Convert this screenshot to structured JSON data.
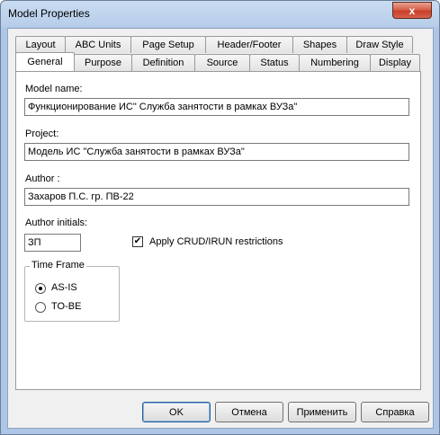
{
  "window": {
    "title": "Model Properties",
    "close_glyph": "x",
    "close_icon": "close-icon"
  },
  "tabs": {
    "row1": [
      "Layout",
      "ABC Units",
      "Page Setup",
      "Header/Footer",
      "Shapes",
      "Draw Style"
    ],
    "row2": [
      "General",
      "Purpose",
      "Definition",
      "Source",
      "Status",
      "Numbering",
      "Display"
    ],
    "active": "General"
  },
  "general": {
    "model_name": {
      "label": "Model name:",
      "value": "Функционирование ИС\" Служба  занятости  в рамках ВУЗа\""
    },
    "project": {
      "label": "Project:",
      "value": "Модель ИС \"Служба занятости в рамках ВУЗа\""
    },
    "author": {
      "label": "Author :",
      "value": "Захаров П.С. гр. ПВ-22"
    },
    "author_initials": {
      "label": "Author initials:",
      "value": "ЗП"
    },
    "crud": {
      "label": "Apply CRUD/IRUN restrictions",
      "checked": true,
      "check_glyph": "✔"
    },
    "time_frame": {
      "title": "Time Frame",
      "options": [
        {
          "label": "AS-IS",
          "selected": true
        },
        {
          "label": "TO-BE",
          "selected": false
        }
      ]
    }
  },
  "buttons": {
    "ok": "OK",
    "cancel": "Отмена",
    "apply": "Применить",
    "help": "Справка"
  }
}
